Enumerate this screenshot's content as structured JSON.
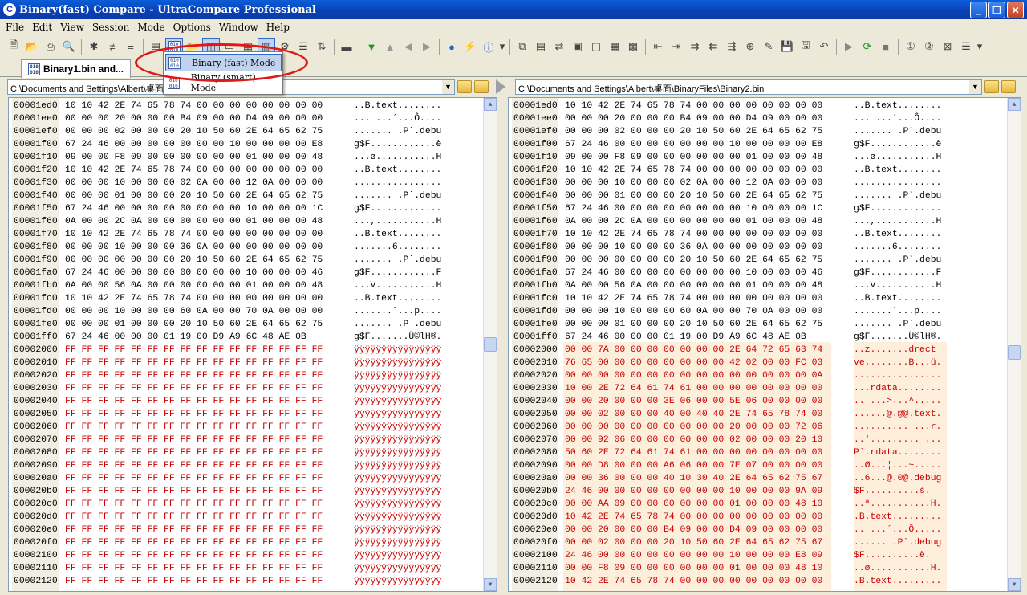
{
  "window": {
    "title": "Binary(fast) Compare - UltraCompare Professional"
  },
  "menu": [
    "File",
    "Edit",
    "View",
    "Session",
    "Mode",
    "Options",
    "Window",
    "Help"
  ],
  "tab": {
    "label": "Binary1.bin and..."
  },
  "dropdown": {
    "items": [
      "Binary (fast) Mode",
      "Binary (smart) Mode"
    ],
    "selected": "Binary (fast) Mode"
  },
  "left": {
    "path": "C:\\Documents and Settings\\Albert\\桌面\\",
    "rows": [
      {
        "addr": "00001ed0",
        "hex": "10 10 42 2E 74 65 78 74 00 00 00 00 00 00 00 00",
        "text": "..B.text........"
      },
      {
        "addr": "00001ee0",
        "hex": "00 00 00 20 00 00 00 B4 09 00 00 D4 09 00 00 00",
        "text": "... ...´...Ô...."
      },
      {
        "addr": "00001ef0",
        "hex": "00 00 00 02 00 00 00 20 10 50 60 2E 64 65 62 75",
        "text": "....... .P`.debu"
      },
      {
        "addr": "00001f00",
        "hex": "67 24 46 00 00 00 00 00 00 00 10 00 00 00 00 E8",
        "text": "g$F............è"
      },
      {
        "addr": "00001f10",
        "hex": "09 00 00 F8 09 00 00 00 00 00 00 01 00 00 00 48",
        "text": "...ø...........H"
      },
      {
        "addr": "00001f20",
        "hex": "10 10 42 2E 74 65 78 74 00 00 00 00 00 00 00 00",
        "text": "..B.text........"
      },
      {
        "addr": "00001f30",
        "hex": "00 00 00 10 00 00 00 02 0A 00 00 12 0A 00 00 00",
        "text": "................"
      },
      {
        "addr": "00001f40",
        "hex": "00 00 00 01 00 00 00 20 10 50 60 2E 64 65 62 75",
        "text": "....... .P`.debu"
      },
      {
        "addr": "00001f50",
        "hex": "67 24 46 00 00 00 00 00 00 00 00 10 00 00 00 1C",
        "text": "g$F............."
      },
      {
        "addr": "00001f60",
        "hex": "0A 00 00 2C 0A 00 00 00 00 00 00 01 00 00 00 48",
        "text": "...,...........H"
      },
      {
        "addr": "00001f70",
        "hex": "10 10 42 2E 74 65 78 74 00 00 00 00 00 00 00 00",
        "text": "..B.text........"
      },
      {
        "addr": "00001f80",
        "hex": "00 00 00 10 00 00 00 36 0A 00 00 00 00 00 00 00",
        "text": ".......6........"
      },
      {
        "addr": "00001f90",
        "hex": "00 00 00 00 00 00 00 20 10 50 60 2E 64 65 62 75",
        "text": "....... .P`.debu"
      },
      {
        "addr": "00001fa0",
        "hex": "67 24 46 00 00 00 00 00 00 00 00 10 00 00 00 46",
        "text": "g$F............F"
      },
      {
        "addr": "00001fb0",
        "hex": "0A 00 00 56 0A 00 00 00 00 00 00 01 00 00 00 48",
        "text": "...V...........H"
      },
      {
        "addr": "00001fc0",
        "hex": "10 10 42 2E 74 65 78 74 00 00 00 00 00 00 00 00",
        "text": "..B.text........"
      },
      {
        "addr": "00001fd0",
        "hex": "00 00 00 10 00 00 00 60 0A 00 00 70 0A 00 00 00",
        "text": ".......`...p...."
      },
      {
        "addr": "00001fe0",
        "hex": "00 00 00 01 00 00 00 20 10 50 60 2E 64 65 62 75",
        "text": "....... .P`.debu"
      },
      {
        "addr": "00001ff0",
        "hex": "67 24 46 00 00 00 01 19 00 D9 A9 6C 48 AE 0B",
        "text": "g$F.......Ù©lH®."
      },
      {
        "addr": "00002000",
        "hex": "FF FF FF FF FF FF FF FF FF FF FF FF FF FF FF FF",
        "text": "ÿÿÿÿÿÿÿÿÿÿÿÿÿÿÿÿ",
        "diff": true
      },
      {
        "addr": "00002010",
        "hex": "FF FF FF FF FF FF FF FF FF FF FF FF FF FF FF FF",
        "text": "ÿÿÿÿÿÿÿÿÿÿÿÿÿÿÿÿ",
        "diff": true
      },
      {
        "addr": "00002020",
        "hex": "FF FF FF FF FF FF FF FF FF FF FF FF FF FF FF FF",
        "text": "ÿÿÿÿÿÿÿÿÿÿÿÿÿÿÿÿ",
        "diff": true
      },
      {
        "addr": "00002030",
        "hex": "FF FF FF FF FF FF FF FF FF FF FF FF FF FF FF FF",
        "text": "ÿÿÿÿÿÿÿÿÿÿÿÿÿÿÿÿ",
        "diff": true
      },
      {
        "addr": "00002040",
        "hex": "FF FF FF FF FF FF FF FF FF FF FF FF FF FF FF FF",
        "text": "ÿÿÿÿÿÿÿÿÿÿÿÿÿÿÿÿ",
        "diff": true
      },
      {
        "addr": "00002050",
        "hex": "FF FF FF FF FF FF FF FF FF FF FF FF FF FF FF FF",
        "text": "ÿÿÿÿÿÿÿÿÿÿÿÿÿÿÿÿ",
        "diff": true
      },
      {
        "addr": "00002060",
        "hex": "FF FF FF FF FF FF FF FF FF FF FF FF FF FF FF FF",
        "text": "ÿÿÿÿÿÿÿÿÿÿÿÿÿÿÿÿ",
        "diff": true
      },
      {
        "addr": "00002070",
        "hex": "FF FF FF FF FF FF FF FF FF FF FF FF FF FF FF FF",
        "text": "ÿÿÿÿÿÿÿÿÿÿÿÿÿÿÿÿ",
        "diff": true
      },
      {
        "addr": "00002080",
        "hex": "FF FF FF FF FF FF FF FF FF FF FF FF FF FF FF FF",
        "text": "ÿÿÿÿÿÿÿÿÿÿÿÿÿÿÿÿ",
        "diff": true
      },
      {
        "addr": "00002090",
        "hex": "FF FF FF FF FF FF FF FF FF FF FF FF FF FF FF FF",
        "text": "ÿÿÿÿÿÿÿÿÿÿÿÿÿÿÿÿ",
        "diff": true
      },
      {
        "addr": "000020a0",
        "hex": "FF FF FF FF FF FF FF FF FF FF FF FF FF FF FF FF",
        "text": "ÿÿÿÿÿÿÿÿÿÿÿÿÿÿÿÿ",
        "diff": true
      },
      {
        "addr": "000020b0",
        "hex": "FF FF FF FF FF FF FF FF FF FF FF FF FF FF FF FF",
        "text": "ÿÿÿÿÿÿÿÿÿÿÿÿÿÿÿÿ",
        "diff": true
      },
      {
        "addr": "000020c0",
        "hex": "FF FF FF FF FF FF FF FF FF FF FF FF FF FF FF FF",
        "text": "ÿÿÿÿÿÿÿÿÿÿÿÿÿÿÿÿ",
        "diff": true
      },
      {
        "addr": "000020d0",
        "hex": "FF FF FF FF FF FF FF FF FF FF FF FF FF FF FF FF",
        "text": "ÿÿÿÿÿÿÿÿÿÿÿÿÿÿÿÿ",
        "diff": true
      },
      {
        "addr": "000020e0",
        "hex": "FF FF FF FF FF FF FF FF FF FF FF FF FF FF FF FF",
        "text": "ÿÿÿÿÿÿÿÿÿÿÿÿÿÿÿÿ",
        "diff": true
      },
      {
        "addr": "000020f0",
        "hex": "FF FF FF FF FF FF FF FF FF FF FF FF FF FF FF FF",
        "text": "ÿÿÿÿÿÿÿÿÿÿÿÿÿÿÿÿ",
        "diff": true
      },
      {
        "addr": "00002100",
        "hex": "FF FF FF FF FF FF FF FF FF FF FF FF FF FF FF FF",
        "text": "ÿÿÿÿÿÿÿÿÿÿÿÿÿÿÿÿ",
        "diff": true
      },
      {
        "addr": "00002110",
        "hex": "FF FF FF FF FF FF FF FF FF FF FF FF FF FF FF FF",
        "text": "ÿÿÿÿÿÿÿÿÿÿÿÿÿÿÿÿ",
        "diff": true
      },
      {
        "addr": "00002120",
        "hex": "FF FF FF FF FF FF FF FF FF FF FF FF FF FF FF FF",
        "text": "ÿÿÿÿÿÿÿÿÿÿÿÿÿÿÿÿ",
        "diff": true
      }
    ]
  },
  "right": {
    "path": "C:\\Documents and Settings\\Albert\\桌面\\BinaryFiles\\Binary2.bin",
    "rows": [
      {
        "addr": "00001ed0",
        "hex": "10 10 42 2E 74 65 78 74 00 00 00 00 00 00 00 00",
        "text": "..B.text........"
      },
      {
        "addr": "00001ee0",
        "hex": "00 00 00 20 00 00 00 B4 09 00 00 D4 09 00 00 00",
        "text": "... ...´...Ô...."
      },
      {
        "addr": "00001ef0",
        "hex": "00 00 00 02 00 00 00 20 10 50 60 2E 64 65 62 75",
        "text": "....... .P`.debu"
      },
      {
        "addr": "00001f00",
        "hex": "67 24 46 00 00 00 00 00 00 00 10 00 00 00 00 E8",
        "text": "g$F............è"
      },
      {
        "addr": "00001f10",
        "hex": "09 00 00 F8 09 00 00 00 00 00 00 01 00 00 00 48",
        "text": "...ø...........H"
      },
      {
        "addr": "00001f20",
        "hex": "10 10 42 2E 74 65 78 74 00 00 00 00 00 00 00 00",
        "text": "..B.text........"
      },
      {
        "addr": "00001f30",
        "hex": "00 00 00 10 00 00 00 02 0A 00 00 12 0A 00 00 00",
        "text": "................"
      },
      {
        "addr": "00001f40",
        "hex": "00 00 00 01 00 00 00 20 10 50 60 2E 64 65 62 75",
        "text": "....... .P`.debu"
      },
      {
        "addr": "00001f50",
        "hex": "67 24 46 00 00 00 00 00 00 00 00 10 00 00 00 1C",
        "text": "g$F............."
      },
      {
        "addr": "00001f60",
        "hex": "0A 00 00 2C 0A 00 00 00 00 00 00 01 00 00 00 48",
        "text": "...,...........H"
      },
      {
        "addr": "00001f70",
        "hex": "10 10 42 2E 74 65 78 74 00 00 00 00 00 00 00 00",
        "text": "..B.text........"
      },
      {
        "addr": "00001f80",
        "hex": "00 00 00 10 00 00 00 36 0A 00 00 00 00 00 00 00",
        "text": ".......6........"
      },
      {
        "addr": "00001f90",
        "hex": "00 00 00 00 00 00 00 20 10 50 60 2E 64 65 62 75",
        "text": "....... .P`.debu"
      },
      {
        "addr": "00001fa0",
        "hex": "67 24 46 00 00 00 00 00 00 00 00 10 00 00 00 46",
        "text": "g$F............F"
      },
      {
        "addr": "00001fb0",
        "hex": "0A 00 00 56 0A 00 00 00 00 00 00 01 00 00 00 48",
        "text": "...V...........H"
      },
      {
        "addr": "00001fc0",
        "hex": "10 10 42 2E 74 65 78 74 00 00 00 00 00 00 00 00",
        "text": "..B.text........"
      },
      {
        "addr": "00001fd0",
        "hex": "00 00 00 10 00 00 00 60 0A 00 00 70 0A 00 00 00",
        "text": ".......`...p...."
      },
      {
        "addr": "00001fe0",
        "hex": "00 00 00 01 00 00 00 20 10 50 60 2E 64 65 62 75",
        "text": "....... .P`.debu"
      },
      {
        "addr": "00001ff0",
        "hex": "67 24 46 00 00 00 01 19 00 D9 A9 6C 48 AE 0B",
        "text": "g$F.......Ù©lH®."
      },
      {
        "addr": "00002000",
        "hex": "00 00 7A 00 00 00 00 00 00 00 2E 64 72 65 63 74",
        "text": "..z.......drect",
        "diff": true
      },
      {
        "addr": "00002010",
        "hex": "76 65 00 00 00 00 00 00 00 00 42 02 00 00 FC 03",
        "text": "ve........B...ü.",
        "diff": true
      },
      {
        "addr": "00002020",
        "hex": "00 00 00 00 00 00 00 00 00 00 00 00 00 00 00 0A",
        "text": "................",
        "diff": true
      },
      {
        "addr": "00002030",
        "hex": "10 00 2E 72 64 61 74 61 00 00 00 00 00 00 00 00",
        "text": "...rdata........",
        "diff": true
      },
      {
        "addr": "00002040",
        "hex": "00 00 20 00 00 00 3E 06 00 00 5E 06 00 00 00 00",
        "text": ".. ...>...^.....",
        "diff": true
      },
      {
        "addr": "00002050",
        "hex": "00 00 02 00 00 00 40 00 40 40 2E 74 65 78 74 00",
        "text": "......@.@@.text.",
        "diff": true
      },
      {
        "addr": "00002060",
        "hex": "00 00 00 00 00 00 00 00 00 00 20 00 00 00 72 06",
        "text": ".......... ...r.",
        "diff": true
      },
      {
        "addr": "00002070",
        "hex": "00 00 92 06 00 00 00 00 00 00 02 00 00 00 20 10",
        "text": "..'......... ...",
        "diff": true
      },
      {
        "addr": "00002080",
        "hex": "50 60 2E 72 64 61 74 61 00 00 00 00 00 00 00 00",
        "text": "P`.rdata........",
        "diff": true
      },
      {
        "addr": "00002090",
        "hex": "00 00 D8 00 00 00 A6 06 00 00 7E 07 00 00 00 00",
        "text": "..Ø...¦...~.....",
        "diff": true
      },
      {
        "addr": "000020a0",
        "hex": "00 00 36 00 00 00 40 10 30 40 2E 64 65 62 75 67",
        "text": "..6...@.0@.debug",
        "diff": true
      },
      {
        "addr": "000020b0",
        "hex": "24 46 00 00 00 00 00 00 00 00 10 00 00 00 9A 09",
        "text": "$F..........š.",
        "diff": true
      },
      {
        "addr": "000020c0",
        "hex": "00 00 AA 09 00 00 00 00 00 00 01 00 00 00 48 10",
        "text": "..ª...........H.",
        "diff": true
      },
      {
        "addr": "000020d0",
        "hex": "10 42 2E 74 65 78 74 00 00 00 00 00 00 00 00 00",
        "text": ".B.text.........",
        "diff": true
      },
      {
        "addr": "000020e0",
        "hex": "00 00 20 00 00 00 B4 09 00 00 D4 09 00 00 00 00",
        "text": ".. ...´...Ô.....",
        "diff": true
      },
      {
        "addr": "000020f0",
        "hex": "00 00 02 00 00 00 20 10 50 60 2E 64 65 62 75 67",
        "text": "...... .P`.debug",
        "diff": true
      },
      {
        "addr": "00002100",
        "hex": "24 46 00 00 00 00 00 00 00 00 10 00 00 00 E8 09",
        "text": "$F..........è.",
        "diff": true
      },
      {
        "addr": "00002110",
        "hex": "00 00 F8 09 00 00 00 00 00 00 01 00 00 00 48 10",
        "text": "..ø...........H.",
        "diff": true
      },
      {
        "addr": "00002120",
        "hex": "10 42 2E 74 65 78 74 00 00 00 00 00 00 00 00 00",
        "text": ".B.text.........",
        "diff": true
      }
    ]
  }
}
